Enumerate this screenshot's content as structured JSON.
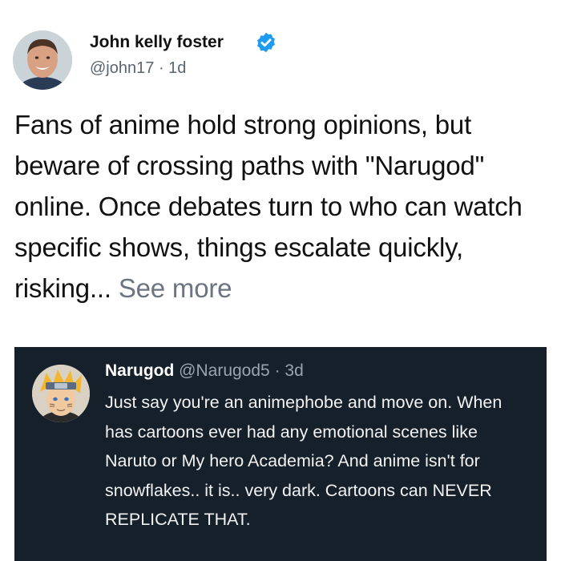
{
  "author": {
    "name": "John kelly foster",
    "handle": "@john17",
    "separator": "·",
    "time": "1d",
    "verified": true
  },
  "post": {
    "text": "Fans of anime hold strong opinions, but beware of crossing paths with \"Narugod\" online. Once debates turn to who can watch specific shows, things escalate quickly, risking...",
    "see_more": "See more"
  },
  "quoted": {
    "name": "Narugod",
    "handle": "@Narugod5",
    "separator": "·",
    "time": "3d",
    "text": "Just say you're an animephobe and move on. When has cartoons ever had any emotional scenes like Naruto or My hero Academia? And anime isn't for snowflakes.. it is.. very dark. Cartoons can NEVER REPLICATE THAT."
  },
  "colors": {
    "verified_badge": "#1d9bf0",
    "quote_background": "#16202b",
    "secondary_text": "#5b6570"
  },
  "icons": {
    "verified": "verified-badge-icon"
  }
}
